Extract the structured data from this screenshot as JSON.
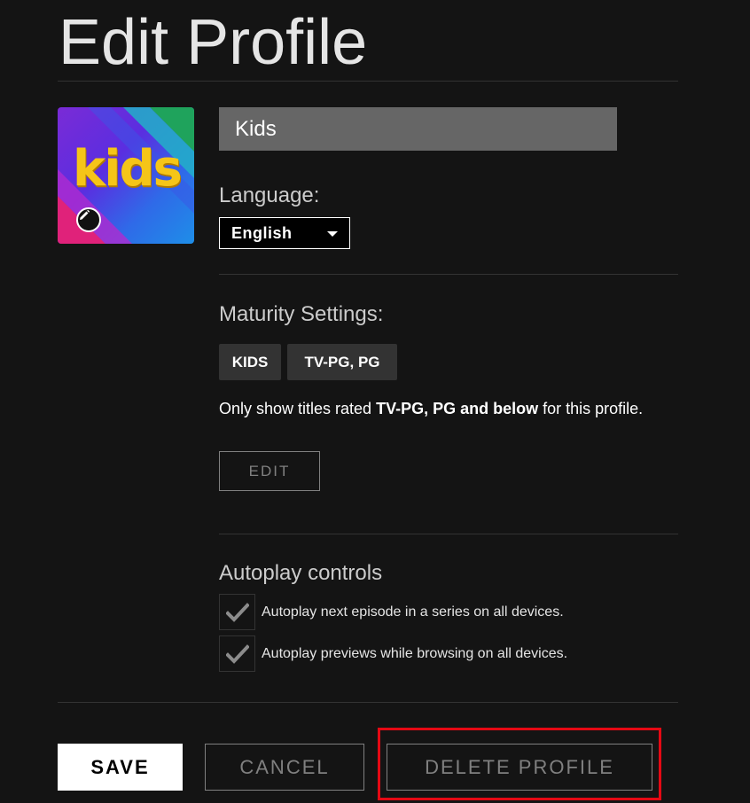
{
  "page": {
    "title": "Edit Profile"
  },
  "profile": {
    "avatar_text": "kids",
    "name_value": "Kids"
  },
  "language": {
    "label": "Language:",
    "selected": "English"
  },
  "maturity": {
    "label": "Maturity Settings:",
    "pills": [
      "KIDS",
      "TV-PG, PG"
    ],
    "desc_prefix": "Only show titles rated ",
    "desc_bold": "TV-PG, PG and below",
    "desc_suffix": " for this profile.",
    "edit_label": "EDIT"
  },
  "autoplay": {
    "label": "Autoplay controls",
    "options": [
      {
        "label": "Autoplay next episode in a series on all devices.",
        "checked": true
      },
      {
        "label": "Autoplay previews while browsing on all devices.",
        "checked": true
      }
    ]
  },
  "actions": {
    "save_label": "SAVE",
    "cancel_label": "CANCEL",
    "delete_label": "DELETE PROFILE"
  },
  "colors": {
    "background": "#141414",
    "input_bg": "#666666",
    "highlight": "#e50914",
    "avatar_yellow": "#f5c518"
  },
  "icons": {
    "avatar_edit": "pencil-icon",
    "dropdown": "caret-down-icon",
    "checkbox": "checkmark-icon"
  }
}
